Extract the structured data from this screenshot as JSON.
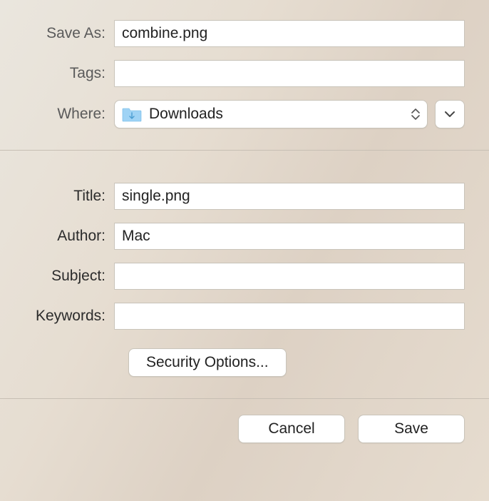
{
  "top": {
    "saveAsLabel": "Save As:",
    "saveAsValue": "combine.png",
    "tagsLabel": "Tags:",
    "tagsValue": "",
    "whereLabel": "Where:",
    "whereValue": "Downloads"
  },
  "meta": {
    "titleLabel": "Title:",
    "titleValue": "single.png",
    "authorLabel": "Author:",
    "authorValue": "Mac",
    "subjectLabel": "Subject:",
    "subjectValue": "",
    "keywordsLabel": "Keywords:",
    "keywordsValue": "",
    "securityOptions": "Security Options..."
  },
  "buttons": {
    "cancel": "Cancel",
    "save": "Save"
  }
}
